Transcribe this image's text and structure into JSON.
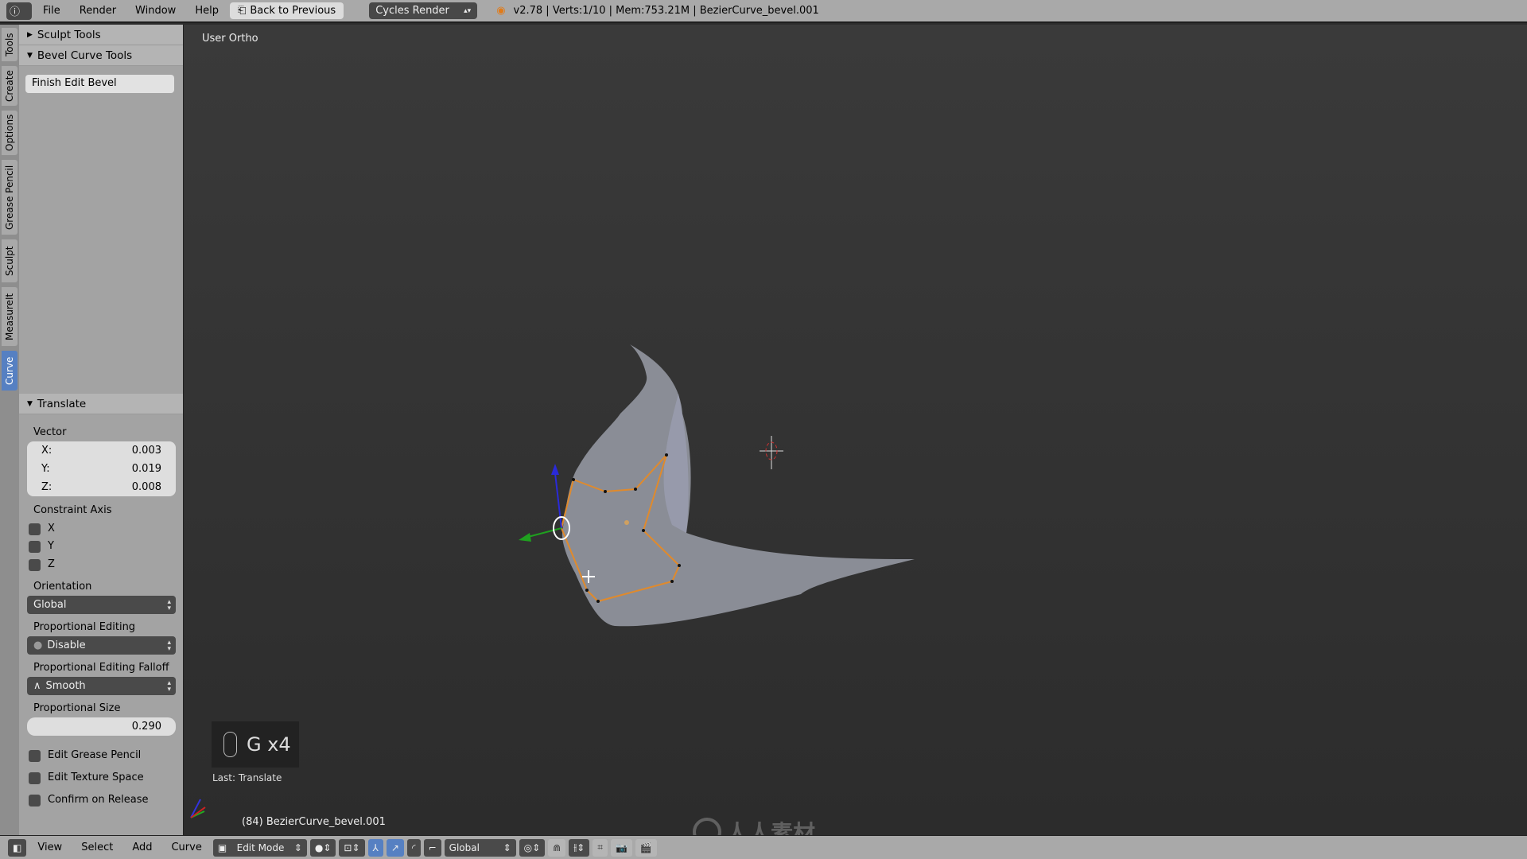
{
  "topbar": {
    "menus": [
      "File",
      "Render",
      "Window",
      "Help"
    ],
    "back_button": "Back to Previous",
    "render_engine": "Cycles Render",
    "stats": "v2.78 | Verts:1/10 | Mem:753.21M | BezierCurve_bevel.001"
  },
  "tabs": [
    "Tools",
    "Create",
    "Options",
    "Grease Pencil",
    "Sculpt",
    "MeasureIt",
    "Curve"
  ],
  "active_tab": "Curve",
  "panel": {
    "sculpt_tools": "Sculpt Tools",
    "bevel_curve_tools": "Bevel Curve Tools",
    "finish_button": "Finish Edit Bevel"
  },
  "operator": {
    "title": "Translate",
    "vector_label": "Vector",
    "x_label": "X:",
    "x": "0.003",
    "y_label": "Y:",
    "y": "0.019",
    "z_label": "Z:",
    "z": "0.008",
    "constraint_label": "Constraint Axis",
    "axes": [
      "X",
      "Y",
      "Z"
    ],
    "orientation_label": "Orientation",
    "orientation": "Global",
    "prop_label": "Proportional Editing",
    "prop": "Disable",
    "falloff_label": "Proportional Editing Falloff",
    "falloff": "Smooth",
    "size_label": "Proportional Size",
    "size": "0.290",
    "checks": [
      "Edit Grease Pencil",
      "Edit Texture Space",
      "Confirm on Release"
    ]
  },
  "viewport": {
    "view_name": "User Ortho",
    "key_display": "G x4",
    "last_op": "Last: Translate",
    "object_info": "(84) BezierCurve_bevel.001",
    "watermark": "人人素材"
  },
  "bottombar": {
    "menus": [
      "View",
      "Select",
      "Add",
      "Curve"
    ],
    "mode": "Edit Mode",
    "orientation": "Global"
  },
  "colors": {
    "selection": "#e08a2c",
    "mesh": "#8a8d96",
    "panel": "#a3a3a3",
    "viewport": "#333333"
  }
}
